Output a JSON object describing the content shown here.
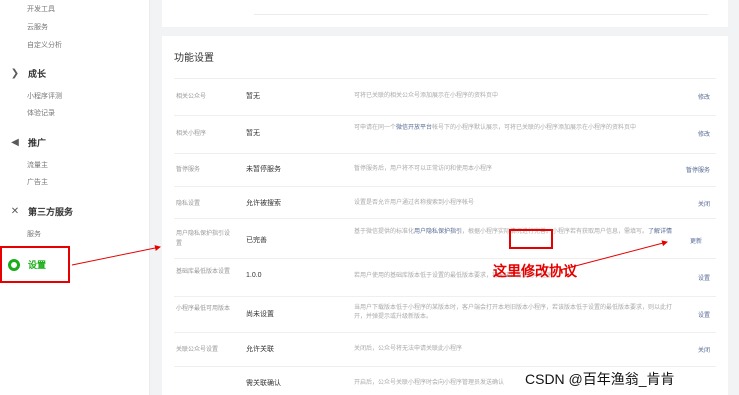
{
  "sidebar": {
    "top_items": [
      "开发工具",
      "云服务",
      "自定义分析"
    ],
    "groups": [
      {
        "icon": "growth-icon",
        "label": "成长",
        "items": [
          "小程序评测",
          "体验记录"
        ]
      },
      {
        "icon": "promotion-icon",
        "label": "推广",
        "items": [
          "流量主",
          "广告主"
        ]
      },
      {
        "icon": "third-party-icon",
        "label": "第三方服务",
        "items": [
          "服务"
        ]
      }
    ],
    "settings_label": "设置"
  },
  "section_title": "功能设置",
  "rows": [
    {
      "label": "相关公众号",
      "value": "暂无",
      "desc": "可将已关联的相关公众号添加展示在小程序的资料页中",
      "action": "修改"
    },
    {
      "label": "相关小程序",
      "value": "暂无",
      "desc_pre": "可申请在同一个",
      "desc_hl": "微信开放平台",
      "desc_post": "帐号下的小程序默认展示，可将已关联的小程序添加展示在小程序的资料页中",
      "action": "修改"
    },
    {
      "label": "暂停服务",
      "value": "未暂停服务",
      "desc": "暂停服务后，用户将不可以正常访问和使用本小程序",
      "action": "暂停服务"
    },
    {
      "label": "隐私设置",
      "value": "允许被搜索",
      "desc": "设置是否允许用户通过名称搜索到小程序帐号",
      "action": "关闭"
    },
    {
      "label": "用户隐私保护指引设置",
      "value": "已完善",
      "desc_pre": "基于微信提供的标准化",
      "desc_hl": "用户隐私保护指引",
      "desc_post": "，根据小程序实际情况进行完善。小程序若有获取用户信息，需填写。",
      "desc_link": "了解详情",
      "action": "更新"
    },
    {
      "label": "基础库最低版本设置",
      "value": "1.0.0",
      "desc": "若用户使用的基础库版本低于设置的最低版本要求，将无法正常使用小程序",
      "action": "设置"
    },
    {
      "label": "小程序最低可用版本",
      "value": "尚未设置",
      "desc": "当用户下载版本低于小程序的某版本时，客户端会打开本地旧版本小程序，若该版本低于设置的最低版本要求，则以此打开，并弹提示或升级新版本。",
      "action": "设置"
    },
    {
      "label": "关联公众号设置",
      "value": "允许关联",
      "desc": "关闭后，公众号将无法申请关联此小程序",
      "action": "关闭"
    },
    {
      "label": "",
      "value": "需关联确认",
      "desc": "开启后，公众号关联小程序时会向小程序管理员发送确认",
      "action": ""
    }
  ],
  "annotation": "这里修改协议",
  "watermark": "CSDN @百年渔翁_肯肯",
  "colors": {
    "accent_green": "#1aad19",
    "link_blue": "#576b95",
    "annotation_red": "#e60000"
  }
}
